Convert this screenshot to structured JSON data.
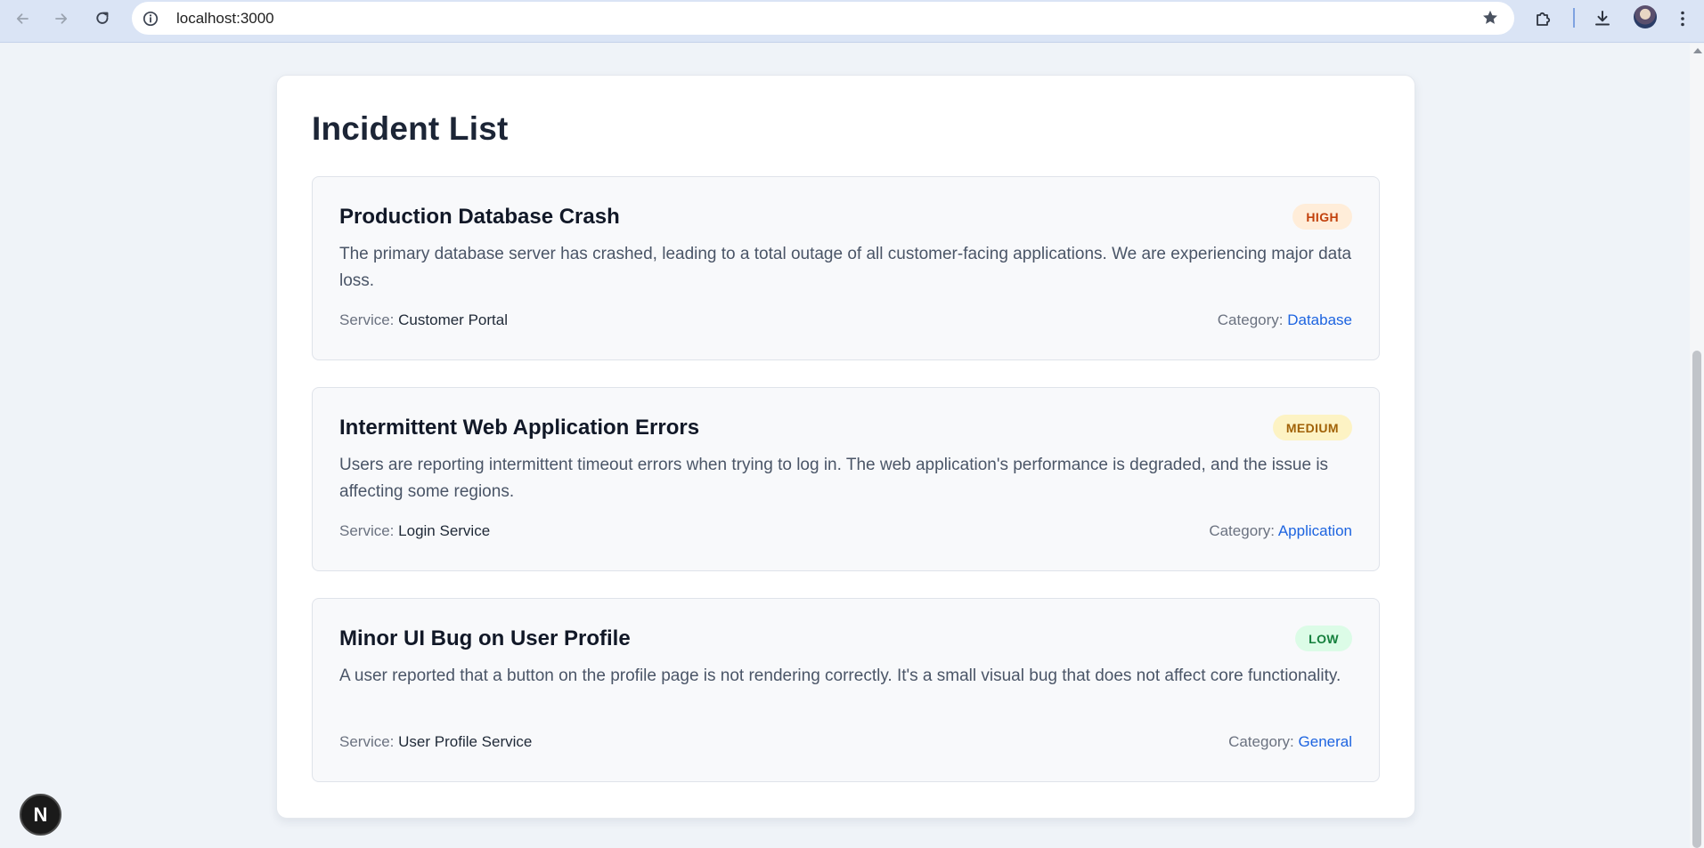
{
  "browser": {
    "url": "localhost:3000",
    "icons": {
      "back": "arrow-left-icon",
      "forward": "arrow-right-icon",
      "reload": "reload-icon",
      "site_info": "site-info-icon",
      "bookmark": "star-icon",
      "extensions": "puzzle-icon",
      "downloads": "download-icon",
      "profile": "avatar",
      "menu": "kebab-menu-icon"
    }
  },
  "page": {
    "title": "Incident List",
    "incidents": [
      {
        "title": "Production Database Crash",
        "severity": "HIGH",
        "severity_colors": {
          "bg": "#ffedd9",
          "fg": "#c2410c"
        },
        "description": "The primary database server has crashed, leading to a total outage of all customer-facing applications. We are experiencing major data loss.",
        "service_label": "Service:",
        "service": "Customer Portal",
        "category_label": "Category:",
        "category": "Database"
      },
      {
        "title": "Intermittent Web Application Errors",
        "severity": "MEDIUM",
        "severity_colors": {
          "bg": "#fdf3c4",
          "fg": "#a16207"
        },
        "description": "Users are reporting intermittent timeout errors when trying to log in. The web application's performance is degraded, and the issue is affecting some regions.",
        "service_label": "Service:",
        "service": "Login Service",
        "category_label": "Category:",
        "category": "Application"
      },
      {
        "title": "Minor UI Bug on User Profile",
        "severity": "LOW",
        "severity_colors": {
          "bg": "#dcfce7",
          "fg": "#15803d"
        },
        "description": "A user reported that a button on the profile page is not rendering correctly. It's a small visual bug that does not affect core functionality.",
        "service_label": "Service:",
        "service": "User Profile Service",
        "category_label": "Category:",
        "category": "General"
      }
    ]
  },
  "dev_indicator": {
    "letter": "N"
  },
  "colors": {
    "accent": "#1d64e0",
    "chrome": "#dae4f5"
  }
}
